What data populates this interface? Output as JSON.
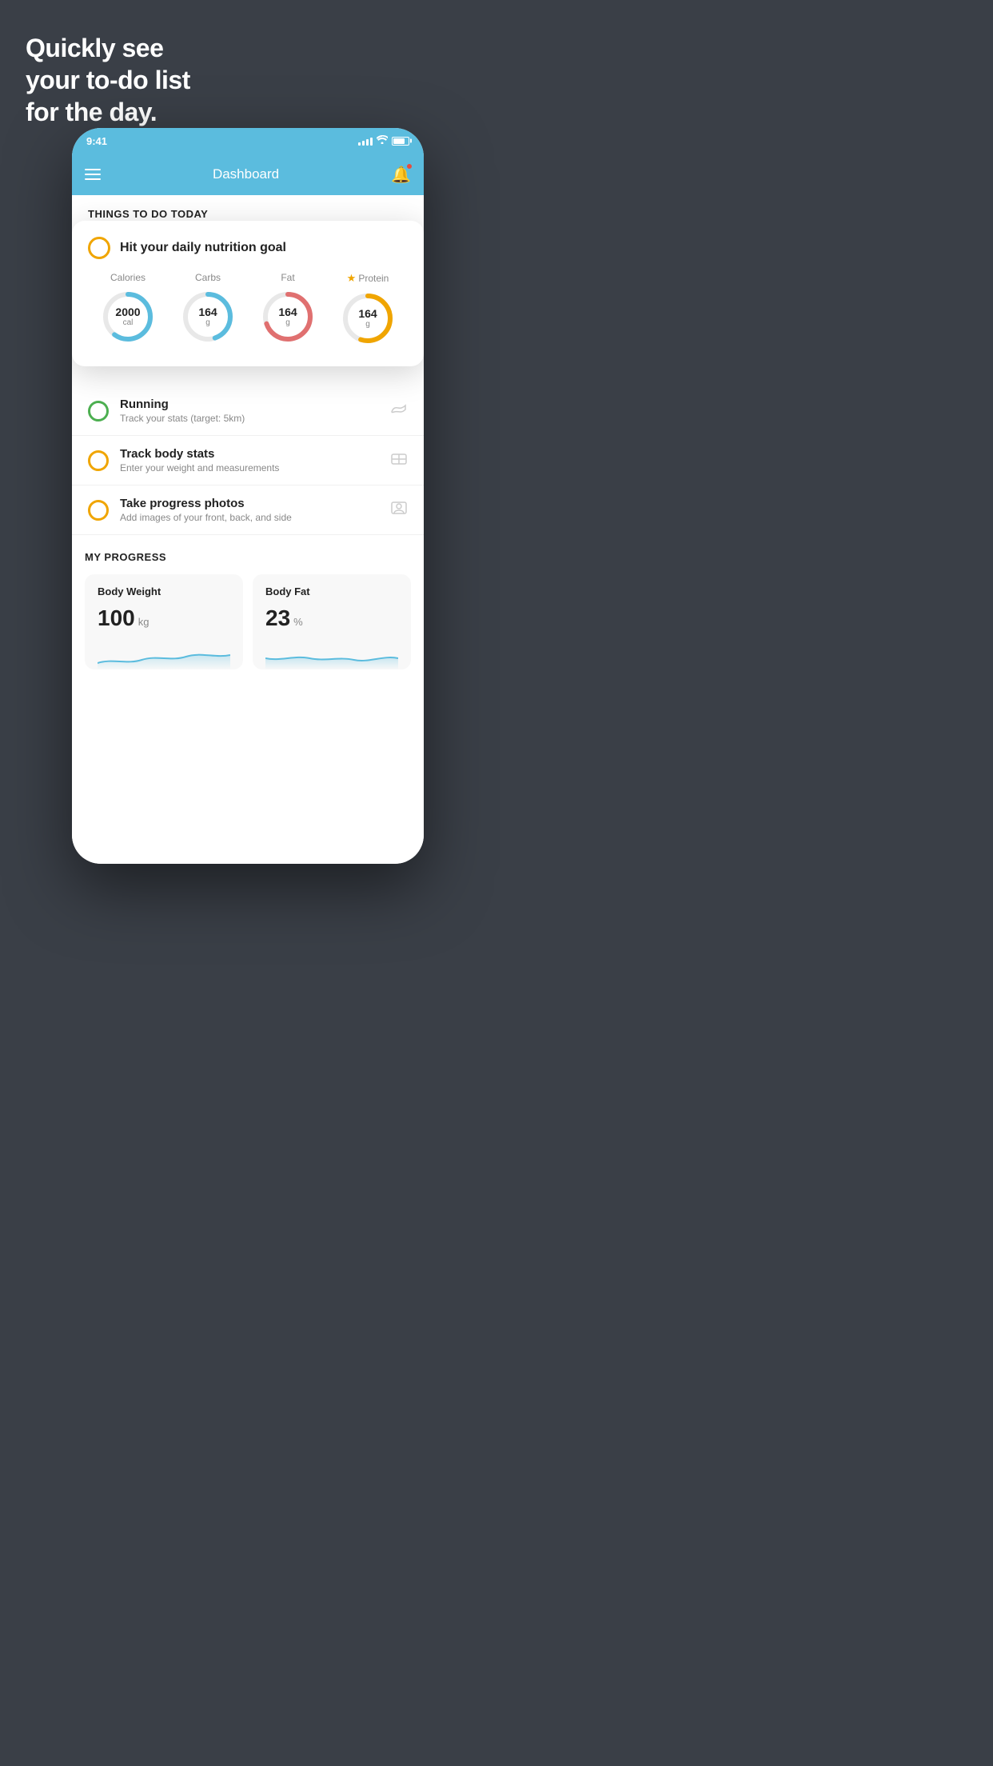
{
  "hero": {
    "line1": "Quickly see",
    "line2": "your to-do list",
    "line3": "for the day."
  },
  "statusBar": {
    "time": "9:41",
    "icons": "signal wifi battery"
  },
  "header": {
    "title": "Dashboard"
  },
  "sectionHeader": "THINGS TO DO TODAY",
  "nutritionCard": {
    "title": "Hit your daily nutrition goal",
    "items": [
      {
        "label": "Calories",
        "value": "2000",
        "unit": "cal",
        "color": "#5bbcde",
        "percent": 60,
        "starred": false
      },
      {
        "label": "Carbs",
        "value": "164",
        "unit": "g",
        "color": "#5bbcde",
        "percent": 45,
        "starred": false
      },
      {
        "label": "Fat",
        "value": "164",
        "unit": "g",
        "color": "#e07070",
        "percent": 70,
        "starred": false
      },
      {
        "label": "Protein",
        "value": "164",
        "unit": "g",
        "color": "#f0a500",
        "percent": 55,
        "starred": true
      }
    ]
  },
  "todoItems": [
    {
      "title": "Running",
      "subtitle": "Track your stats (target: 5km)",
      "circleColor": "green",
      "icon": "shoe"
    },
    {
      "title": "Track body stats",
      "subtitle": "Enter your weight and measurements",
      "circleColor": "yellow",
      "icon": "scale"
    },
    {
      "title": "Take progress photos",
      "subtitle": "Add images of your front, back, and side",
      "circleColor": "yellow",
      "icon": "person"
    }
  ],
  "progressSection": {
    "title": "MY PROGRESS",
    "cards": [
      {
        "title": "Body Weight",
        "value": "100",
        "unit": "kg"
      },
      {
        "title": "Body Fat",
        "value": "23",
        "unit": "%"
      }
    ]
  }
}
